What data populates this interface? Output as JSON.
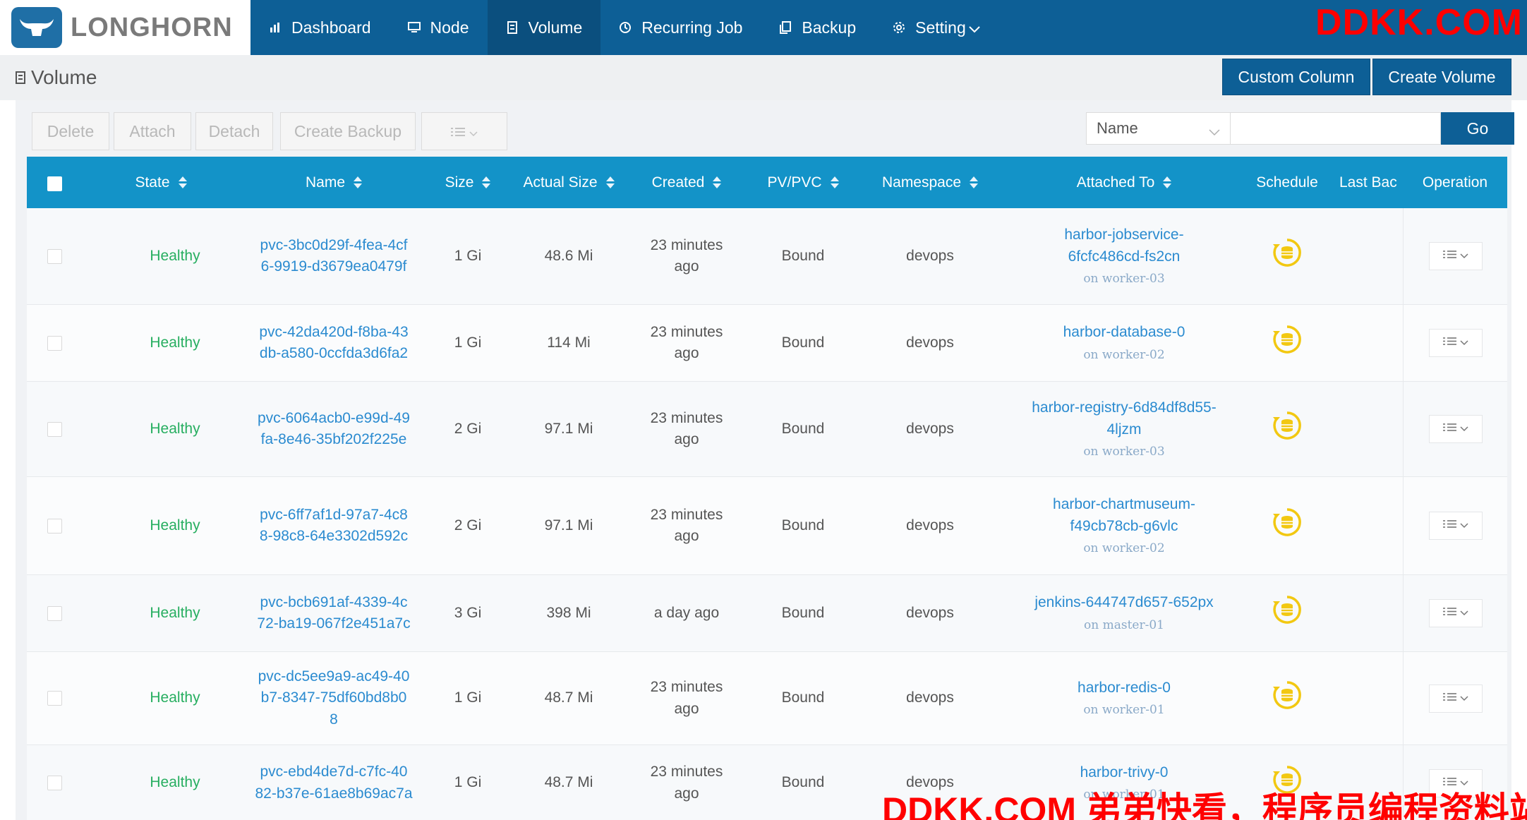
{
  "brand": {
    "name": "LONGHORN"
  },
  "nav": [
    {
      "label": "Dashboard",
      "icon": "bar-chart-icon"
    },
    {
      "label": "Node",
      "icon": "monitor-icon"
    },
    {
      "label": "Volume",
      "icon": "volume-icon",
      "active": true
    },
    {
      "label": "Recurring Job",
      "icon": "clock-icon"
    },
    {
      "label": "Backup",
      "icon": "copy-icon"
    },
    {
      "label": "Setting",
      "icon": "gear-icon"
    }
  ],
  "watermark_top": "DDKK.COM",
  "page": {
    "title": "Volume"
  },
  "header_buttons": {
    "custom_column": "Custom Column",
    "create_volume": "Create Volume"
  },
  "toolbar": {
    "delete": "Delete",
    "attach": "Attach",
    "detach": "Detach",
    "create_backup": "Create Backup"
  },
  "search": {
    "field": "Name",
    "value": "",
    "go": "Go"
  },
  "columns": {
    "state": "State",
    "name": "Name",
    "size": "Size",
    "actual_size": "Actual Size",
    "created": "Created",
    "pvpvc": "PV/PVC",
    "namespace": "Namespace",
    "attached_to": "Attached To",
    "schedule": "Schedule",
    "last_backup": "Last Bac",
    "operation": "Operation"
  },
  "rows": [
    {
      "state": "Healthy",
      "name": [
        "pvc-3bc0d29f-4fea-4cf",
        "6-9919-d3679ea0479f"
      ],
      "size": "1 Gi",
      "actual": "48.6 Mi",
      "created": [
        "23 minutes",
        "ago"
      ],
      "pv": "Bound",
      "ns": "devops",
      "attached": [
        "harbor-jobservice-",
        "6fcfc486cd-fs2cn"
      ],
      "node": "on worker-03"
    },
    {
      "state": "Healthy",
      "name": [
        "pvc-42da420d-f8ba-43",
        "db-a580-0ccfda3d6fa2"
      ],
      "size": "1 Gi",
      "actual": "114 Mi",
      "created": [
        "23 minutes",
        "ago"
      ],
      "pv": "Bound",
      "ns": "devops",
      "attached": [
        "harbor-database-0"
      ],
      "node": "on worker-02"
    },
    {
      "state": "Healthy",
      "name": [
        "pvc-6064acb0-e99d-49",
        "fa-8e46-35bf202f225e"
      ],
      "size": "2 Gi",
      "actual": "97.1 Mi",
      "created": [
        "23 minutes",
        "ago"
      ],
      "pv": "Bound",
      "ns": "devops",
      "attached": [
        "harbor-registry-6d84df8d55-",
        "4ljzm"
      ],
      "node": "on worker-03"
    },
    {
      "state": "Healthy",
      "name": [
        "pvc-6ff7af1d-97a7-4c8",
        "8-98c8-64e3302d592c"
      ],
      "size": "2 Gi",
      "actual": "97.1 Mi",
      "created": [
        "23 minutes",
        "ago"
      ],
      "pv": "Bound",
      "ns": "devops",
      "attached": [
        "harbor-chartmuseum-",
        "f49cb78cb-g6vlc"
      ],
      "node": "on worker-02"
    },
    {
      "state": "Healthy",
      "name": [
        "pvc-bcb691af-4339-4c",
        "72-ba19-067f2e451a7c"
      ],
      "size": "3 Gi",
      "actual": "398 Mi",
      "created": [
        "a day ago"
      ],
      "pv": "Bound",
      "ns": "devops",
      "attached": [
        "jenkins-644747d657-652px"
      ],
      "node": "on master-01"
    },
    {
      "state": "Healthy",
      "name": [
        "pvc-dc5ee9a9-ac49-40",
        "b7-8347-75df60bd8b0",
        "8"
      ],
      "size": "1 Gi",
      "actual": "48.7 Mi",
      "created": [
        "23 minutes",
        "ago"
      ],
      "pv": "Bound",
      "ns": "devops",
      "attached": [
        "harbor-redis-0"
      ],
      "node": "on worker-01"
    },
    {
      "state": "Healthy",
      "name": [
        "pvc-ebd4de7d-c7fc-40",
        "82-b37e-61ae8b69ac7a"
      ],
      "size": "1 Gi",
      "actual": "48.7 Mi",
      "created": [
        "23 minutes",
        "ago"
      ],
      "pv": "Bound",
      "ns": "devops",
      "attached": [
        "harbor-trivy-0"
      ],
      "node": "on worker-01"
    }
  ],
  "watermark_bottom": "DDKK.COM 弟弟快看，程序员编程资料站",
  "colors": {
    "nav_bg": "#0d5f96",
    "table_header": "#1393c8",
    "healthy": "#27ae60",
    "link": "#2b8bd0",
    "schedule_icon": "#f2c811"
  }
}
